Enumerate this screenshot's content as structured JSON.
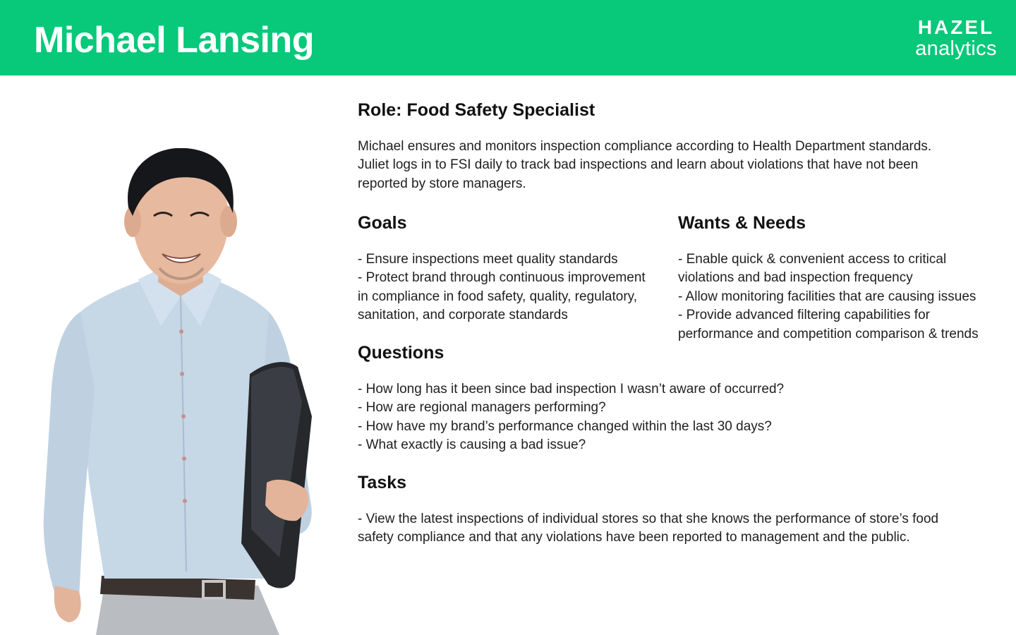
{
  "header": {
    "name": "Michael Lansing",
    "brand_top": "HAZEL",
    "brand_bottom": "analytics",
    "background_color": "#08c87a"
  },
  "role": {
    "heading": "Role: Food Safety Specialist",
    "description_lines": [
      "Michael ensures and monitors inspection compliance according to Health Department standards.",
      "Juliet logs in to FSI daily to track bad inspections and learn about violations that have not been",
      "reported by store managers."
    ]
  },
  "goals": {
    "heading": "Goals",
    "lines": [
      "- Ensure inspections meet quality standards",
      "- Protect brand through continuous improvement",
      "in compliance in food safety, quality, regulatory,",
      "sanitation, and corporate standards"
    ]
  },
  "wants": {
    "heading": "Wants & Needs",
    "lines": [
      "- Enable quick & convenient access to critical",
      "violations and bad inspection frequency",
      "- Allow monitoring facilities that are causing issues",
      "- Provide advanced filtering capabilities for",
      "performance and competition comparison & trends"
    ]
  },
  "questions": {
    "heading": "Questions",
    "lines": [
      "- How long has it been since bad inspection I wasn’t aware of occurred?",
      "- How are regional managers performing?",
      "- How have my brand’s performance changed within the last 30 days?",
      "- What exactly is causing a bad issue?"
    ]
  },
  "tasks": {
    "heading": "Tasks",
    "lines": [
      "- View the latest inspections of individual stores so that she knows the performance of store’s food",
      "safety compliance and that any violations have been reported to management and the public."
    ]
  }
}
